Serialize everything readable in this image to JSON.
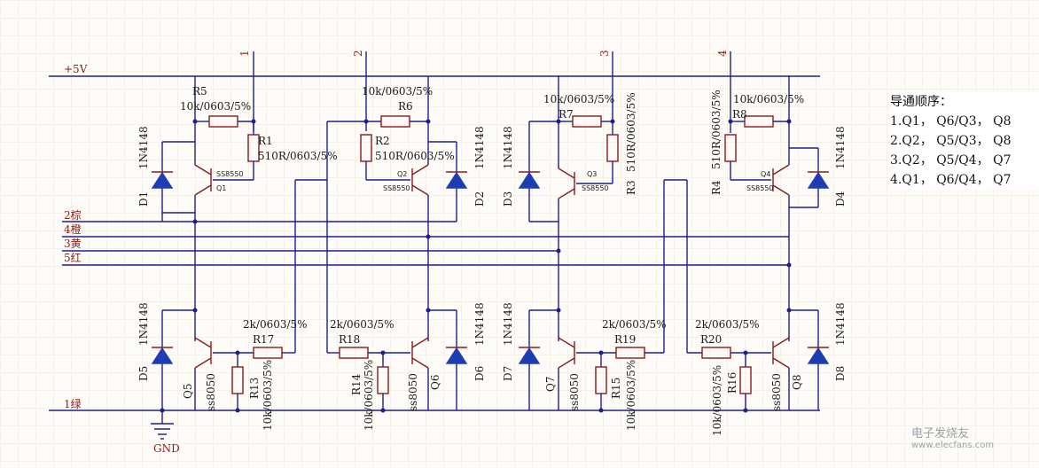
{
  "nets": {
    "vcc": "+5V",
    "gnd": "GND",
    "wire_green": "1绿",
    "wire_brown": "2棕",
    "wire_orange": "4橙",
    "wire_yellow": "3黄",
    "wire_red": "5红",
    "conn1": "1",
    "conn2": "2",
    "conn3": "3",
    "conn4": "4"
  },
  "top": {
    "r5": "R5",
    "r5_value": "10k/0603/5%",
    "r6": "R6",
    "r6_value": "10k/0603/5%",
    "r7": "R7",
    "r7_value": "10k/0603/5%",
    "r8": "R8",
    "r8_value": "10k/0603/5%",
    "r1": "R1",
    "r1_value": "510R/0603/5%",
    "r2": "R2",
    "r2_value": "510R/0603/5%",
    "r3": "R3",
    "r3_value": "510R/0603/5%",
    "r4": "R4",
    "r4_value": "510R/0603/5%",
    "q1": "Q1",
    "q2": "Q2",
    "q3": "Q3",
    "q4": "Q4",
    "pnp_part": "SS8550",
    "d1": "D1",
    "d2": "D2",
    "d3": "D3",
    "d4": "D4",
    "diode_part": "1N4148"
  },
  "bottom": {
    "r17": "R17",
    "r17_value": "2k/0603/5%",
    "r18": "R18",
    "r18_value": "2k/0603/5%",
    "r19": "R19",
    "r19_value": "2k/0603/5%",
    "r20": "R20",
    "r20_value": "2k/0603/5%",
    "r13": "R13",
    "r13_value": "10k/0603/5%",
    "r14": "R14",
    "r14_value": "10k/0603/5%",
    "r15": "R15",
    "r15_value": "10k/0603/5%",
    "r16": "R16",
    "r16_value": "10k/0603/5%",
    "q5": "Q5",
    "q6": "Q6",
    "q7": "Q7",
    "q8": "Q8",
    "npn_part": "ss8050",
    "d5": "D5",
    "d6": "D6",
    "d7": "D7",
    "d8": "D8",
    "diode_part": "1N4148"
  },
  "sequence": {
    "title": "导通顺序：",
    "steps": [
      "1.Q1， Q6/Q3， Q8",
      "2.Q2， Q5/Q3， Q8",
      "3.Q2， Q5/Q4， Q7",
      "4.Q1， Q6/Q4， Q7"
    ]
  },
  "watermark": {
    "brand": "电子发烧友",
    "url": "www.elecfans.com"
  }
}
